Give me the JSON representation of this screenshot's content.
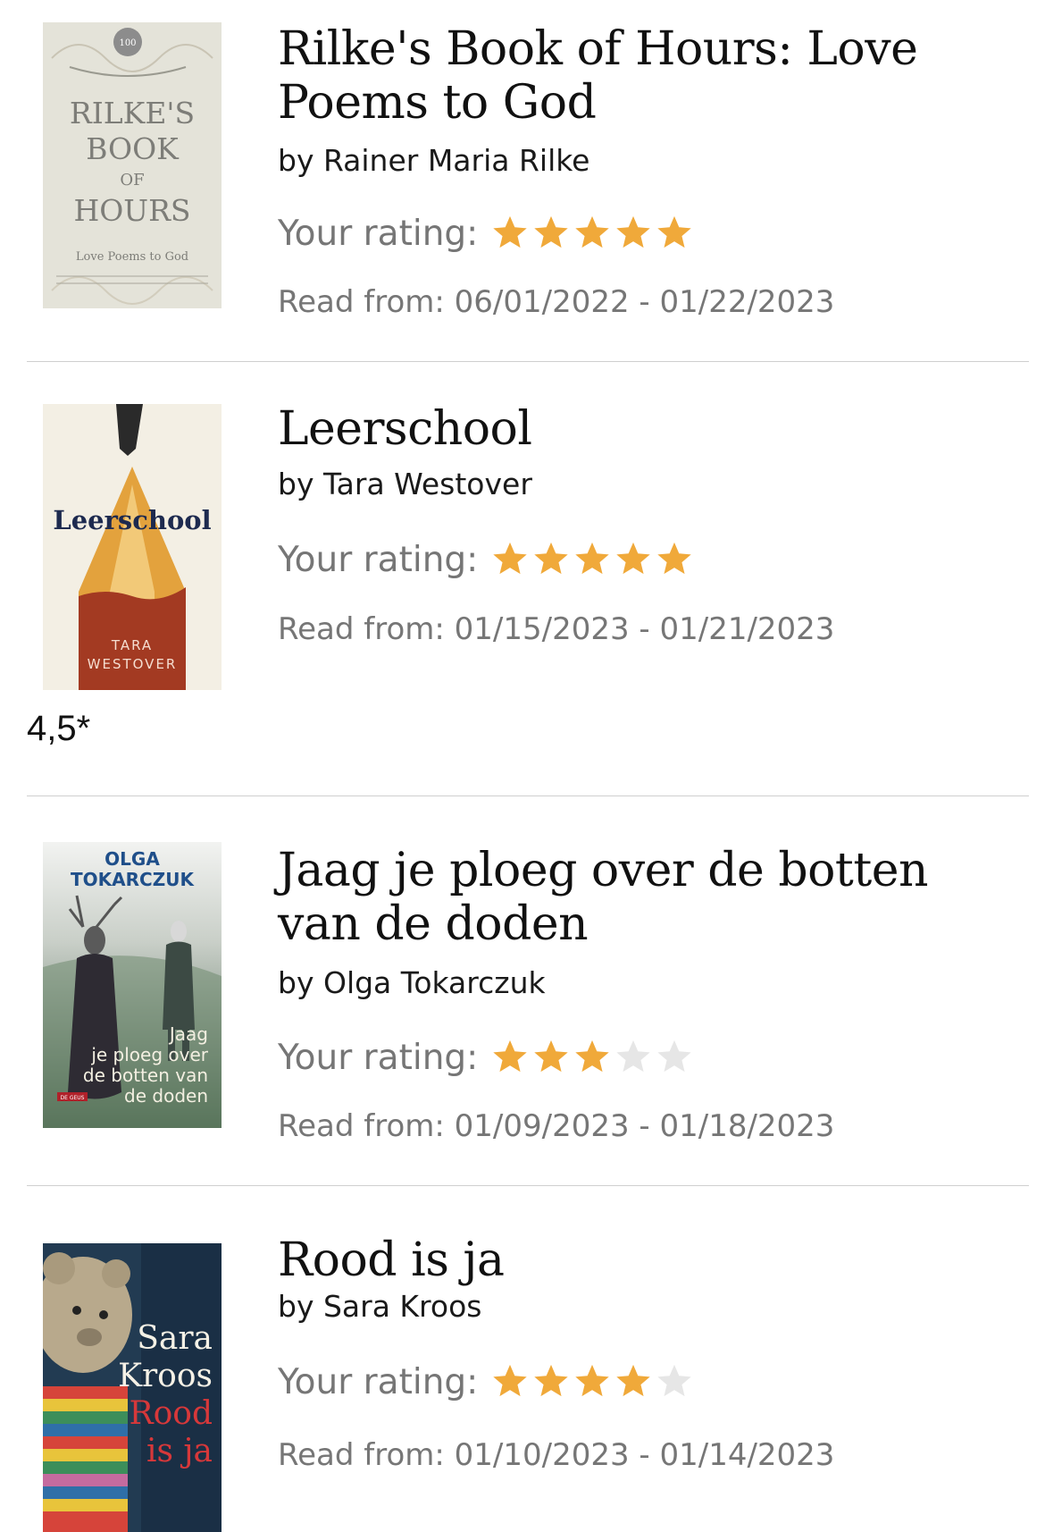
{
  "colors": {
    "star_filled": "#F0A93A",
    "star_empty": "#E6E6E6",
    "divider": "#CFCFCF",
    "muted_text": "#767676"
  },
  "books": [
    {
      "title": "Rilke's Book of Hours: Love Poems to God",
      "author": "by Rainer Maria Rilke",
      "rating_label": "Your rating:",
      "rating": 5,
      "read_dates": "Read from: 06/01/2022 - 01/22/2023",
      "cover": {
        "badge": "100",
        "line1": "RILKE'S",
        "line2": "BOOK",
        "line3": "OF",
        "line4": "HOURS",
        "subtitle": "Love Poems to God"
      }
    },
    {
      "title": "Leerschool",
      "author": "by Tara Westover",
      "rating_label": "Your rating:",
      "rating": 5,
      "read_dates": "Read from: 01/15/2023 - 01/21/2023",
      "note": "4,5*",
      "cover": {
        "title": "Leerschool",
        "author_line1": "TARA",
        "author_line2": "WESTOVER"
      }
    },
    {
      "title": "Jaag je ploeg over de botten van de doden",
      "author": "by Olga Tokarczuk",
      "rating_label": "Your rating:",
      "rating": 3,
      "read_dates": "Read from: 01/09/2023 - 01/18/2023",
      "cover": {
        "author_line1": "OLGA",
        "author_line2": "TOKARCZUK",
        "title_line1": "Jaag",
        "title_line2": "je ploeg over",
        "title_line3": "de botten van",
        "title_line4": "de doden",
        "publisher": "DE GEUS"
      }
    },
    {
      "title": "Rood is ja",
      "author": "by Sara Kroos",
      "rating_label": "Your rating:",
      "rating": 4,
      "read_dates": "Read from: 01/10/2023 - 01/14/2023",
      "cover": {
        "author_line1": "Sara",
        "author_line2": "Kroos",
        "title_line1": "Rood",
        "title_line2": "is ja"
      }
    }
  ]
}
